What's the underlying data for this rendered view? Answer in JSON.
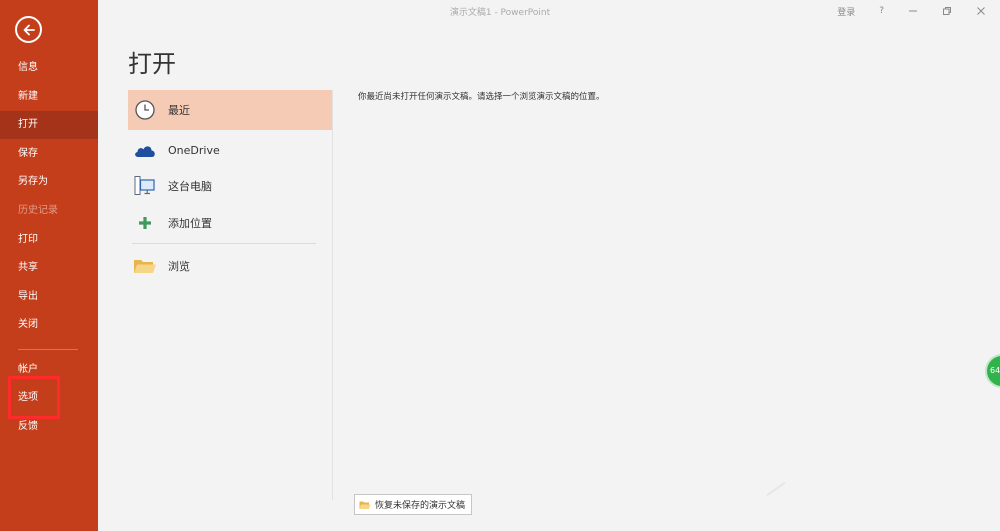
{
  "window": {
    "title": "演示文稿1  -  PowerPoint",
    "signin_label": "登录",
    "help_label": "?"
  },
  "sidebar": {
    "items": [
      {
        "label": "信息"
      },
      {
        "label": "新建"
      },
      {
        "label": "打开"
      },
      {
        "label": "保存"
      },
      {
        "label": "另存为"
      },
      {
        "label": "历史记录"
      },
      {
        "label": "打印"
      },
      {
        "label": "共享"
      },
      {
        "label": "导出"
      },
      {
        "label": "关闭"
      },
      {
        "label": "帐户"
      },
      {
        "label": "选项"
      },
      {
        "label": "反馈"
      }
    ],
    "active": "打开"
  },
  "main": {
    "title": "打开",
    "locations": [
      {
        "label": "最近",
        "icon": "clock-icon"
      },
      {
        "label": "OneDrive",
        "icon": "cloud-icon"
      },
      {
        "label": "这台电脑",
        "icon": "computer-icon"
      },
      {
        "label": "添加位置",
        "icon": "plus-icon"
      },
      {
        "label": "浏览",
        "icon": "folder-icon"
      }
    ],
    "message": "你最近尚未打开任何演示文稿。请选择一个浏览演示文稿的位置。",
    "recover_button": "恢复未保存的演示文稿"
  },
  "widget": {
    "label": "64"
  },
  "colors": {
    "sidebar_bg": "#c43e1c",
    "sidebar_active": "#a5331a",
    "selected_bg": "#f6cbb6",
    "highlight": "#ff2b2b"
  }
}
